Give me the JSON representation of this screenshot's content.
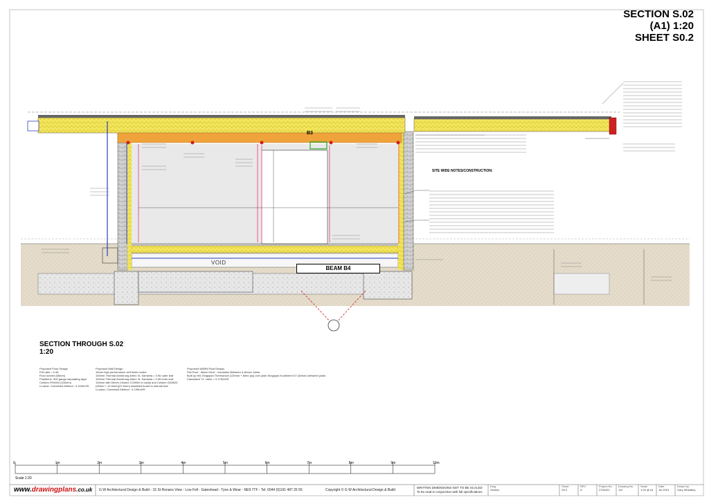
{
  "title": {
    "line1": "SECTION S.02",
    "line2": "(A1) 1:20",
    "line3": "SHEET S0.2"
  },
  "section_label": {
    "line1": "SECTION THROUGH S.02",
    "line2": "1:20"
  },
  "labels": {
    "beam_b3": "B3",
    "beam_b4": "BEAM B4",
    "void": "VOID",
    "site_wide_notes": "SITE WIDE NOTES/CONSTRUCTION:"
  },
  "notes": {
    "floor": {
      "title": "Proposed Floor Design",
      "lines": [
        "P/A ratio = 0.46",
        "Floor screed (65mm)",
        "Polythene, 500 gauge separating layer",
        "Celotex FR4000 (100mm)",
        "U-value, Combined Method : 0.11W/m²K"
      ]
    },
    "wall": {
      "title": "Proposed Wall Design",
      "lines": [
        "15mm high performance self finish render",
        "100mm Thermal Armstrong Airtec XL Samkela = 0.96 outer leaf",
        "100mm Thermal Armstrong Airtec XL Samkela = 0.96 inner leaf",
        "100mm with 50mm Celotex CG5000 in cavity and Celotex GD5025",
        "(25mm + 12.5mm)(37.5mm) insulated board to internal leaf",
        "U-value, Combined Method : 0.19W/m²K"
      ]
    },
    "roof": {
      "title": "Proposed WARM Roof Design",
      "lines": [
        "Flat Roof - Warm Deck - Insulation Between & Above Joists",
        "Built up felt, Kingspan Thermaroof (120mm + 8mm ply) over plain Kingspan Kooltherm K7 (50mm) between joists",
        "Calculated \"U\" value = 0.17W/m²K"
      ]
    }
  },
  "scale_bar": {
    "label": "Scale 1:20",
    "ticks": [
      "0",
      "1m",
      "2m",
      "3m",
      "4m",
      "5m",
      "6m",
      "7m",
      "8m",
      "9m",
      "10m"
    ]
  },
  "footer": {
    "logo_www": "www.",
    "logo_drawing": "drawing",
    "logo_plans": "plans",
    "logo_uk": ".co.uk",
    "company": "G W Architectural Design & Build - 15 St Ronans View - Low Fell - Gateshead - Tyne & Wear - NE9 7TF - Tel: 0044 (0)191 487 25 55",
    "copyright": "Copyright © G W Architectural Design & Build",
    "warning_line1": "WRITTEN DIMENSIONS NOT TO BE SCALED",
    "warning_line2": "To be read in conjunction with full specifications",
    "dwg_key": "Dwg",
    "dwg_val": "Section",
    "sheet_key": "Sheet",
    "sheet_val": "S0.2",
    "rev_key": "REV",
    "rev_val": "A",
    "project_key": "Project No.",
    "project_val": "2700421",
    "drawing_key": "Drawing No.",
    "drawing_val": "110",
    "scale_key": "Scale",
    "scale_val": "1:20 @ A1",
    "date_key": "Date",
    "date_val": "Jul 2015",
    "drawn_key": "Drawn by",
    "drawn_val": "Gary Wheatley"
  },
  "colors": {
    "insulation": "#f2e55c",
    "insulation_dark": "#d9c21c",
    "stud": "#e8a020",
    "brick": "#c9c9c9",
    "ground": "#e5dccb",
    "pink_line": "#e85a8a",
    "blue_line": "#2a3fbf",
    "red_leader": "#cc1f1f",
    "green_box": "#22aa22"
  }
}
